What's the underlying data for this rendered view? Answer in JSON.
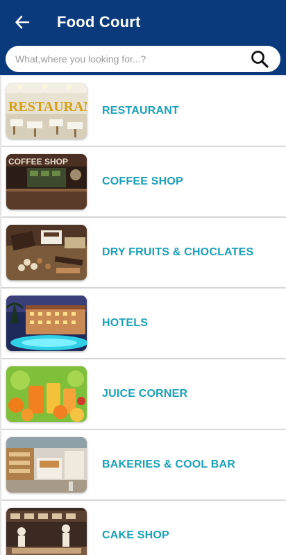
{
  "header": {
    "title": "Food Court",
    "back_icon": "arrow-left-icon",
    "background": "#0a3a7b"
  },
  "search": {
    "placeholder": "What,where you looking for...?",
    "value": "",
    "icon": "search-icon"
  },
  "categories": [
    {
      "label": "RESTAURANT",
      "thumb_text": "RESTAURANT"
    },
    {
      "label": "COFFEE SHOP",
      "thumb_text": "COFFEE SHOP"
    },
    {
      "label": "DRY FRUITS & CHOCLATES"
    },
    {
      "label": "HOTELS"
    },
    {
      "label": "JUICE CORNER"
    },
    {
      "label": "BAKERIES & COOL BAR"
    },
    {
      "label": "CAKE SHOP"
    }
  ],
  "colors": {
    "accent": "#1aa0b8",
    "header": "#0a3a7b",
    "list_bg": "#e9e9e9"
  }
}
